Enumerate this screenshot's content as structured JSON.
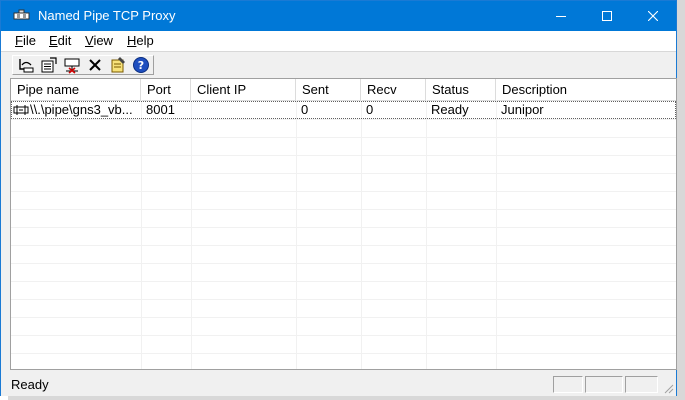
{
  "window": {
    "title": "Named Pipe TCP Proxy",
    "app_icon": "pipe-icon",
    "controls": {
      "minimize": "minimize-icon",
      "maximize": "maximize-icon",
      "close": "close-icon"
    }
  },
  "menu": {
    "items": [
      {
        "accel": "F",
        "rest": "ile"
      },
      {
        "accel": "E",
        "rest": "dit"
      },
      {
        "accel": "V",
        "rest": "iew"
      },
      {
        "accel": "H",
        "rest": "elp"
      }
    ]
  },
  "toolbar": {
    "buttons": [
      "new-pipe-icon",
      "properties-icon",
      "disconnect-icon",
      "delete-icon",
      "edit-icon",
      "help-icon"
    ]
  },
  "list": {
    "columns": [
      "Pipe name",
      "Port",
      "Client IP",
      "Sent",
      "Recv",
      "Status",
      "Description"
    ],
    "rows": [
      {
        "pipe_name": "\\\\.\\pipe\\gns3_vb...",
        "port": "8001",
        "client_ip": "",
        "sent": "0",
        "recv": "0",
        "status": "Ready",
        "description": "Junipor"
      }
    ]
  },
  "statusbar": {
    "text": "Ready"
  },
  "background_fragment": "te",
  "colors": {
    "titlebar": "#0078d7",
    "help": "#1f4fbf",
    "delete": "#000000"
  }
}
